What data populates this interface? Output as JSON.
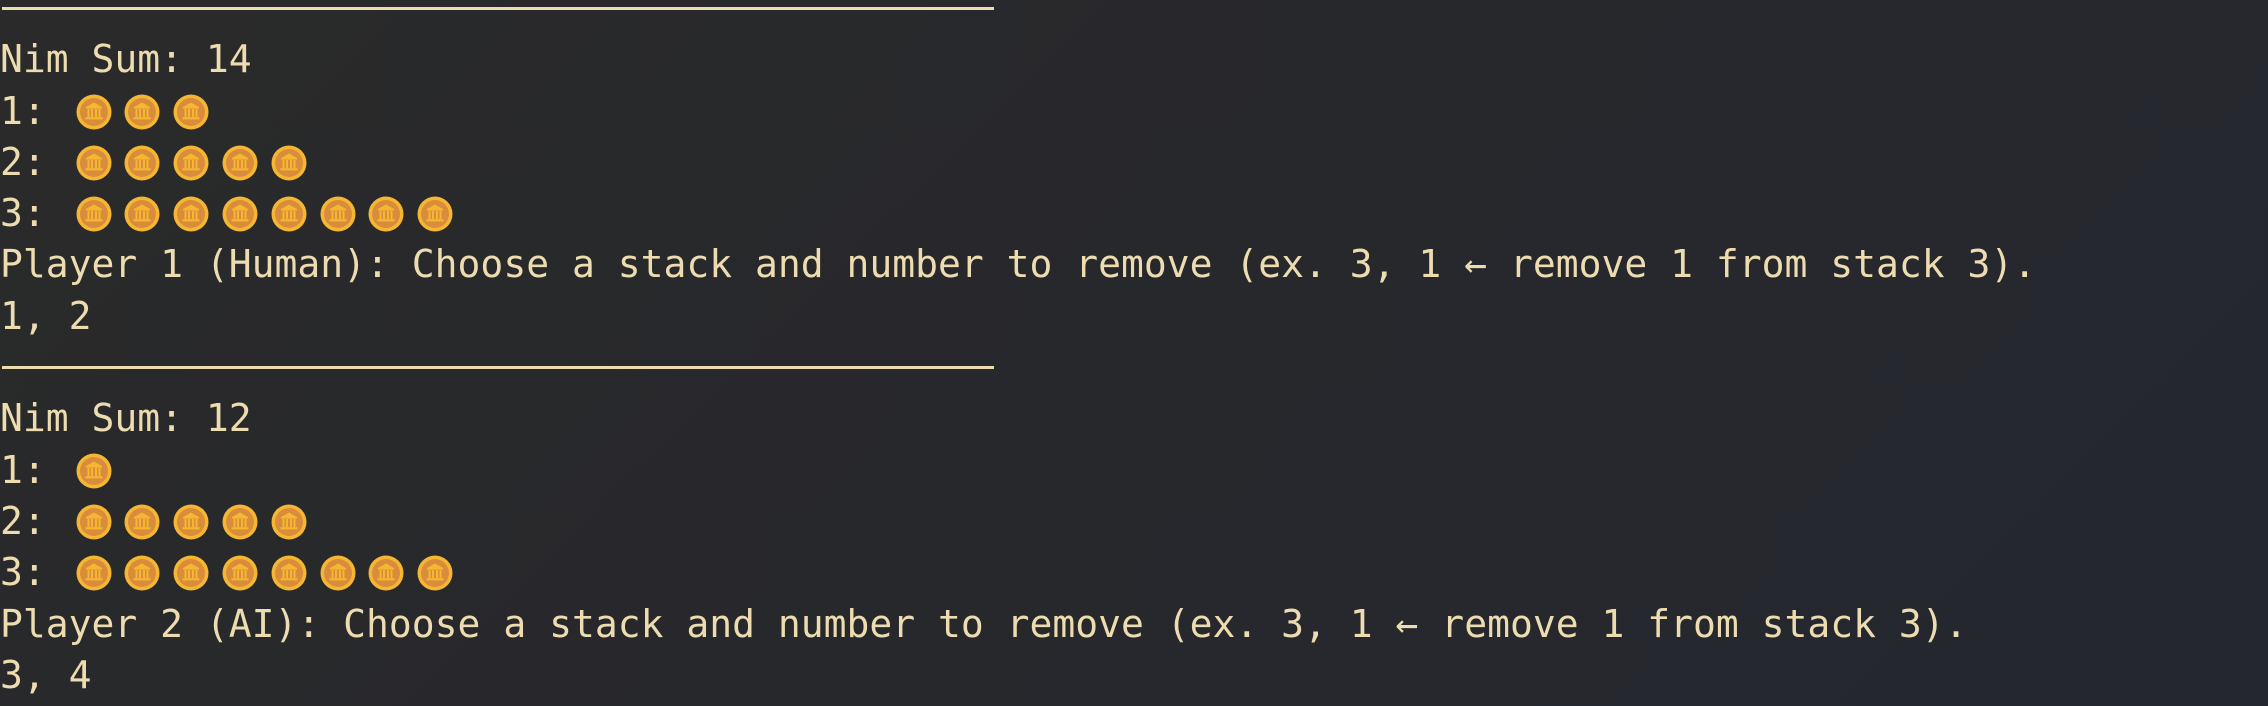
{
  "colors": {
    "text": "#ecdcb0",
    "coin_outer": "#f5b731",
    "coin_inner": "#d98c3c"
  },
  "turns": [
    {
      "nim_sum_label": "Nim Sum: 14",
      "stacks": [
        {
          "label": "1: ",
          "count": 3
        },
        {
          "label": "2: ",
          "count": 5
        },
        {
          "label": "3: ",
          "count": 8
        }
      ],
      "prompt": "Player 1 (Human): Choose a stack and number to remove (ex. 3, 1 ← remove 1 from stack 3).",
      "input": "1, 2"
    },
    {
      "nim_sum_label": "Nim Sum: 12",
      "stacks": [
        {
          "label": "1: ",
          "count": 1
        },
        {
          "label": "2: ",
          "count": 5
        },
        {
          "label": "3: ",
          "count": 8
        }
      ],
      "prompt": "Player 2 (AI): Choose a stack and number to remove (ex. 3, 1 ← remove 1 from stack 3).",
      "input": "3, 4"
    }
  ]
}
